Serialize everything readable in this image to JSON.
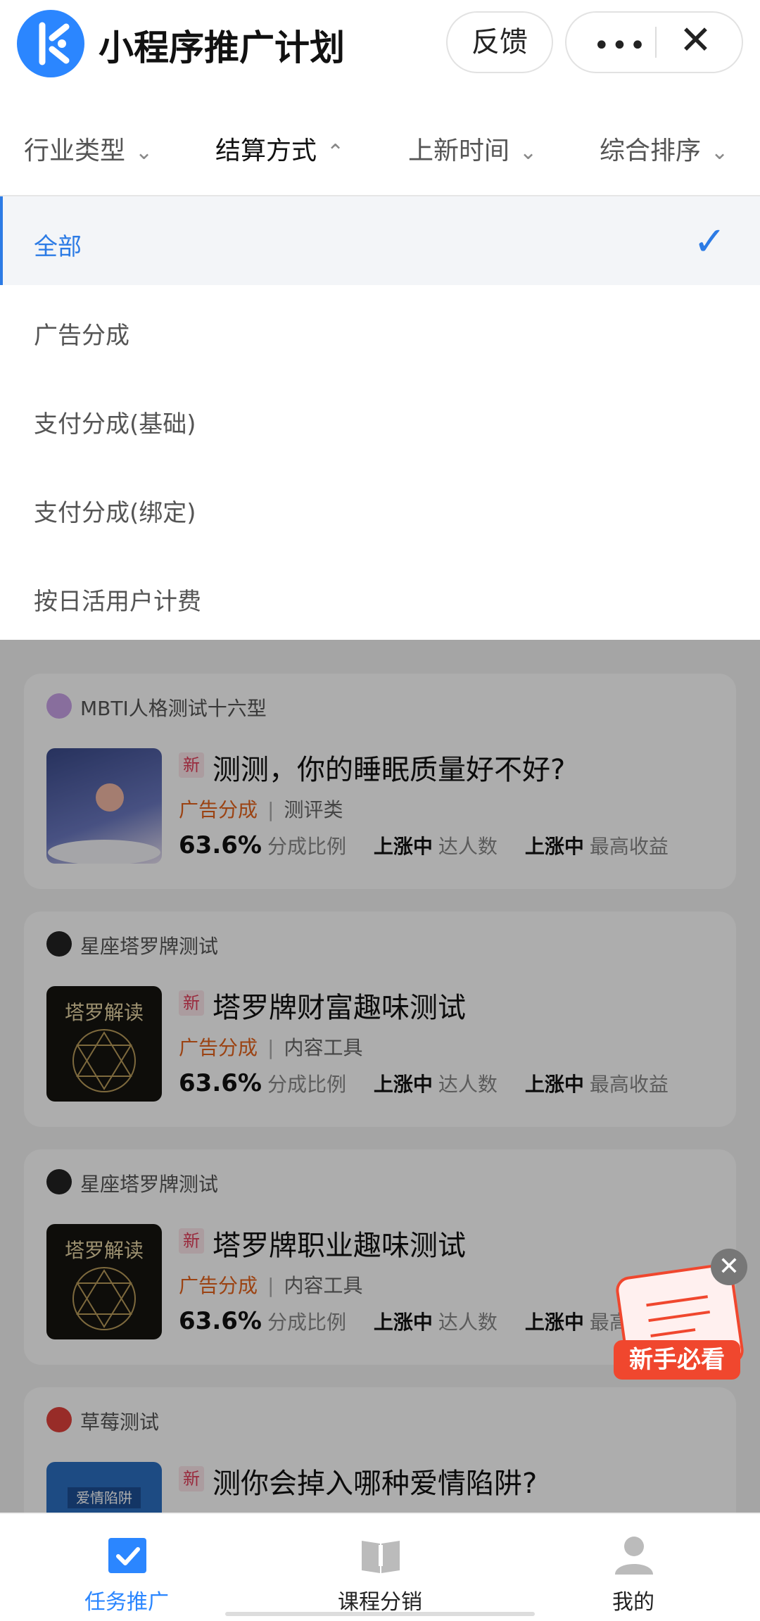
{
  "header": {
    "title": "小程序推广计划",
    "feedback_label": "反馈",
    "more_label": "•••",
    "close_label": "✕"
  },
  "filters": [
    {
      "label": "行业类型",
      "chevron": "⌄",
      "active": false
    },
    {
      "label": "结算方式",
      "chevron": "⌃",
      "active": true
    },
    {
      "label": "上新时间",
      "chevron": "⌄",
      "active": false
    },
    {
      "label": "综合排序",
      "chevron": "⌄",
      "active": false
    }
  ],
  "dropdown": {
    "options": [
      {
        "label": "全部",
        "selected": true
      },
      {
        "label": "广告分成",
        "selected": false
      },
      {
        "label": "支付分成(基础)",
        "selected": false
      },
      {
        "label": "支付分成(绑定)",
        "selected": false
      },
      {
        "label": "按日活用户计费",
        "selected": false
      }
    ],
    "check_mark": "✓"
  },
  "cards": [
    {
      "app_name": "MBTI人格测试十六型",
      "badge": "新",
      "plan_title": "测测，你的睡眠质量好不好?",
      "pay_type": "广告分成",
      "separator": "|",
      "category": "测评类",
      "share_value": "63.6%",
      "share_label": "分成比例",
      "fans_value": "上涨中",
      "fans_label": "达人数",
      "income_value": "上涨中",
      "income_label": "最高收益"
    },
    {
      "app_name": "星座塔罗牌测试",
      "badge": "新",
      "plan_title": "塔罗牌财富趣味测试",
      "pay_type": "广告分成",
      "separator": "|",
      "category": "内容工具",
      "share_value": "63.6%",
      "share_label": "分成比例",
      "fans_value": "上涨中",
      "fans_label": "达人数",
      "income_value": "上涨中",
      "income_label": "最高收益",
      "thumb_text": "塔罗解读"
    },
    {
      "app_name": "星座塔罗牌测试",
      "badge": "新",
      "plan_title": "塔罗牌职业趣味测试",
      "pay_type": "广告分成",
      "separator": "|",
      "category": "内容工具",
      "share_value": "63.6%",
      "share_label": "分成比例",
      "fans_value": "上涨中",
      "fans_label": "达人数",
      "income_value": "上涨中",
      "income_label": "最高收益",
      "thumb_text": "塔罗解读"
    },
    {
      "app_name": "草莓测试",
      "badge": "新",
      "plan_title": "测你会掉入哪种爱情陷阱?",
      "thumb_text": "爱情陷阱"
    }
  ],
  "promo": {
    "label": "新手必看",
    "close_label": "✕"
  },
  "tabbar": [
    {
      "label": "任务推广",
      "active": true
    },
    {
      "label": "课程分销",
      "active": false
    },
    {
      "label": "我的",
      "active": false
    }
  ],
  "colors": {
    "accent": "#2c7be5",
    "pay_orange": "#e5631d",
    "badge_red": "#e23e5a",
    "promo_red": "#f0472e"
  }
}
